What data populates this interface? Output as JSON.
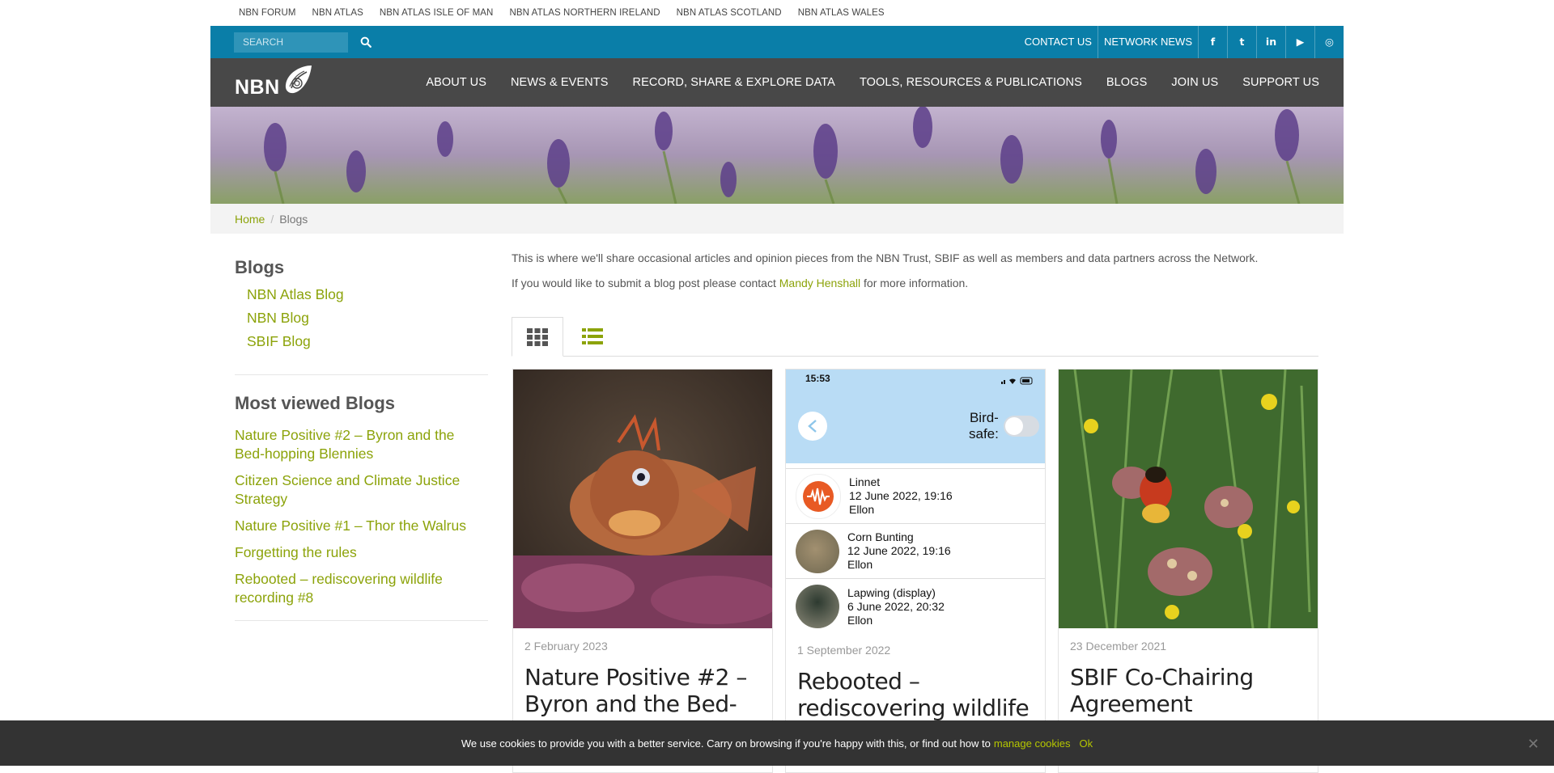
{
  "top_links": [
    "NBN FORUM",
    "NBN ATLAS",
    "NBN ATLAS ISLE OF MAN",
    "NBN ATLAS NORTHERN IRELAND",
    "NBN ATLAS SCOTLAND",
    "NBN ATLAS WALES"
  ],
  "search": {
    "placeholder": "SEARCH",
    "icon": "search-icon"
  },
  "utility_links": {
    "contact": "CONTACT US",
    "network_news": "NETWORK NEWS"
  },
  "social_icons": [
    "facebook-icon",
    "twitter-icon",
    "linkedin-icon",
    "youtube-icon",
    "instagram-icon"
  ],
  "social_glyphs": [
    "f",
    "t",
    "in",
    "▶",
    "◎"
  ],
  "logo": {
    "text": "NBN"
  },
  "main_nav": [
    "ABOUT US",
    "NEWS & EVENTS",
    "RECORD, SHARE & EXPLORE DATA",
    "TOOLS, RESOURCES & PUBLICATIONS",
    "BLOGS",
    "JOIN US",
    "SUPPORT US"
  ],
  "breadcrumb": {
    "home": "Home",
    "separator": "/",
    "current": "Blogs"
  },
  "sidebar": {
    "heading": "Blogs",
    "items": [
      "NBN Atlas Blog",
      "NBN Blog",
      "SBIF Blog"
    ],
    "most_viewed_heading": "Most viewed Blogs",
    "most_viewed": [
      "Nature Positive #2 – Byron and the Bed-hopping Blennies",
      "Citizen Science and Climate Justice Strategy",
      "Nature Positive #1 – Thor the Walrus",
      "Forgetting the rules",
      "Rebooted – rediscovering wildlife recording #8"
    ]
  },
  "intro": {
    "line1": "This is where we'll share occasional articles and opinion pieces from the NBN Trust, SBIF as well as members and data partners across the Network.",
    "line2_before": "If you would like to submit a blog post please contact ",
    "line2_link": "Mandy Henshall",
    "line2_after": " for more information."
  },
  "view_tabs": {
    "grid": "grid-view-icon",
    "list": "list-view-icon"
  },
  "cards": [
    {
      "date": "2 February 2023",
      "title": "Nature Positive #2 – Byron and the Bed-"
    },
    {
      "date": "1 September 2022",
      "title": "Rebooted – rediscovering wildlife"
    },
    {
      "date": "23 December 2021",
      "title": "SBIF Co-Chairing Agreement"
    }
  ],
  "phone_screen": {
    "time": "15:53",
    "toggle_label_1": "Bird-",
    "toggle_label_2": "safe:",
    "records": [
      {
        "species": "Linnet",
        "when": "12 June 2022, 19:16",
        "where": "Ellon"
      },
      {
        "species": "Corn Bunting",
        "when": "12 June 2022, 19:16",
        "where": "Ellon"
      },
      {
        "species": "Lapwing (display)",
        "when": "6 June 2022, 20:32",
        "where": "Ellon"
      }
    ]
  },
  "cookie": {
    "text": "We use cookies to provide you with a better service. Carry on browsing if you're happy with this, or find out how to",
    "manage": "manage cookies",
    "ok": "Ok",
    "close": "✕"
  },
  "colors": {
    "accent": "#8ca30a",
    "blue_bar": "#0a7ea8",
    "nav_dark": "#484848",
    "cookie_bar": "#333333"
  }
}
